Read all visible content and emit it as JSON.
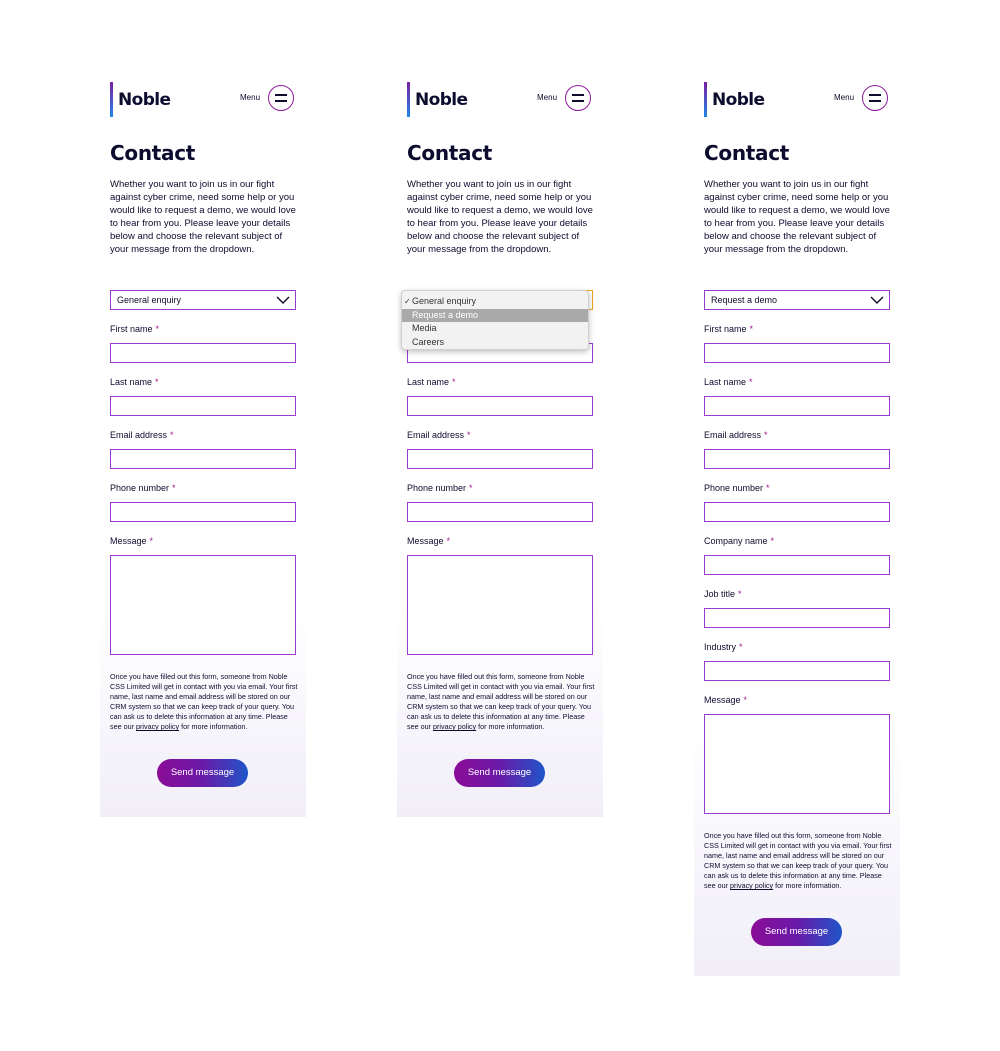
{
  "brand": {
    "name": "Noble",
    "menu_label": "Menu"
  },
  "page": {
    "title": "Contact",
    "intro": "Whether you want to join us in our fight against cyber crime, need some help or you would like to request a demo, we would love to hear from you. Please leave your details below and choose the relevant subject of your message from the dropdown."
  },
  "form": {
    "subject_default": "General enquiry",
    "subject_demo": "Request a demo",
    "required_mark": "*",
    "fields": {
      "first_name": "First name",
      "last_name": "Last name",
      "email": "Email address",
      "phone": "Phone number",
      "company": "Company name",
      "job_title": "Job title",
      "industry": "Industry",
      "message": "Message"
    },
    "disclaimer_text": "Once you have filled out this form, someone from Noble CSS Limited will get in contact with you via email. Your first name, last name and email address will be stored on our CRM system so that we can keep track of your query. You can ask us to delete this information at any time. Please see our ",
    "privacy_link": "privacy policy",
    "disclaimer_end": " for more information.",
    "submit_label": "Send message"
  },
  "dropdown": {
    "check": "✓",
    "options": [
      "General enquiry",
      "Request a demo",
      "Media",
      "Careers"
    ]
  },
  "colors": {
    "accent_purple": "#8e1b9c",
    "field_border": "#9b3bd0",
    "focus_border": "#f0a020",
    "button_gradient_start": "#8a0c96",
    "button_gradient_end": "#1f55c8"
  }
}
